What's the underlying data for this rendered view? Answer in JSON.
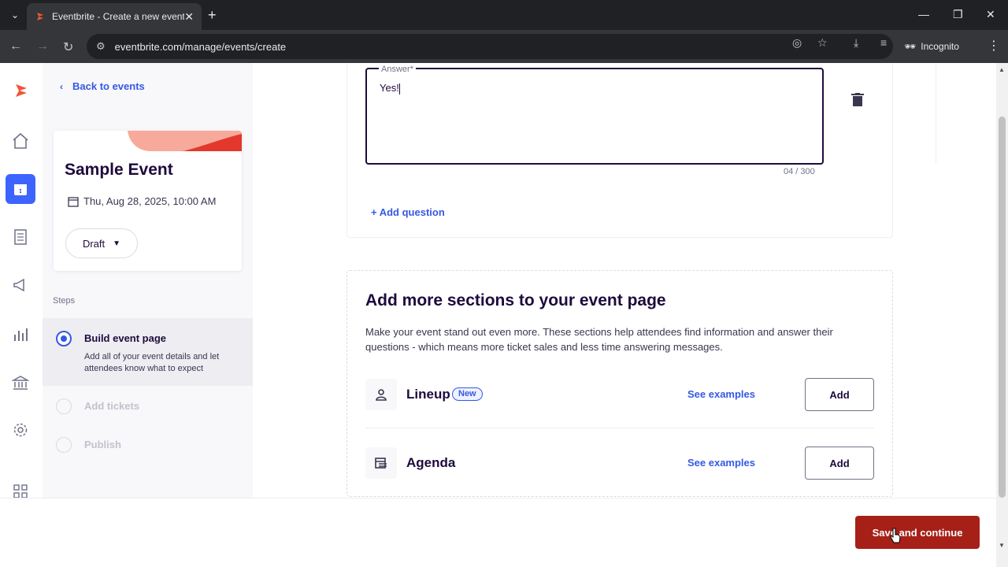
{
  "browser": {
    "tab_title": "Eventbrite - Create a new event",
    "url": "eventbrite.com/manage/events/create",
    "incognito_label": "Incognito"
  },
  "sidebar": {
    "back_label": "Back to events",
    "event": {
      "name": "Sample Event",
      "date": "Thu, Aug 28, 2025, 10:00 AM",
      "status": "Draft"
    },
    "steps_heading": "Steps",
    "steps": [
      {
        "title": "Build event page",
        "description": "Add all of your event details and let attendees know what to expect",
        "state": "active"
      },
      {
        "title": "Add tickets",
        "state": "disabled"
      },
      {
        "title": "Publish",
        "state": "disabled"
      }
    ]
  },
  "faq": {
    "answer_label": "Answer",
    "answer_required_mark": "*",
    "answer_value": "Yes!",
    "char_counter": "04 / 300",
    "add_question_label": "+ Add question"
  },
  "sections": {
    "heading": "Add more sections to your event page",
    "description": "Make your event stand out even more. These sections help attendees find information and answer their questions - which means more ticket sales and less time answering messages.",
    "items": [
      {
        "name": "Lineup",
        "badge": "New",
        "see_examples": "See examples",
        "add_label": "Add",
        "icon": "person-icon"
      },
      {
        "name": "Agenda",
        "badge": "",
        "see_examples": "See examples",
        "add_label": "Add",
        "icon": "calendar-list-icon"
      }
    ]
  },
  "footer": {
    "save_label": "Save and continue"
  },
  "colors": {
    "brand_orange": "#f05537",
    "primary_blue": "#3659e3",
    "save_red": "#a62018",
    "text_dark": "#1e0a3c"
  }
}
